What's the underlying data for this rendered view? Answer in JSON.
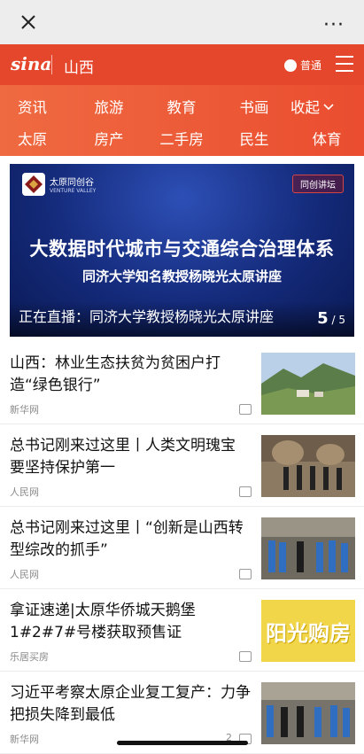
{
  "topbar": {
    "more_label": "···"
  },
  "header": {
    "logo_text": "sina",
    "region": "山西",
    "mode_label": "普通"
  },
  "nav": {
    "row1": [
      "资讯",
      "旅游",
      "教育",
      "书画"
    ],
    "collapse_label": "收起",
    "row2": [
      "太原",
      "房产",
      "二手房",
      "民生",
      "体育"
    ]
  },
  "banner": {
    "org_name": "太原同创谷",
    "org_sub": "VENTURE VALLEY",
    "badge": "同创讲坛",
    "title": "大数据时代城市与交通综合治理体系",
    "subtitle": "同济大学知名教授杨晓光太原讲座",
    "caption": "正在直播：同济大学教授杨晓光太原讲座",
    "page_current": "5",
    "page_total": "/ 5"
  },
  "news": [
    {
      "headline": "山西：林业生态扶贫为贫困户打造“绿色银行”",
      "source": "新华网",
      "comments": ""
    },
    {
      "headline": "总书记刚来过这里丨人类文明瑰宝 要坚持保护第一",
      "source": "人民网",
      "comments": ""
    },
    {
      "headline": "总书记刚来过这里丨“创新是山西转型综改的抓手”",
      "source": "人民网",
      "comments": ""
    },
    {
      "headline": "拿证速递|太原华侨城天鹅堡1#2#7#号楼获取预售证",
      "source": "乐居买房",
      "comments": ""
    },
    {
      "headline": "习近平考察太原企业复工复产：力争把损失降到最低",
      "source": "新华网",
      "comments": "2"
    }
  ],
  "thumb_text": {
    "ad": "阳光购房"
  },
  "colors": {
    "brand": "#e5472c",
    "nav_start": "#ef6a41",
    "banner_bg": "#142a7a"
  }
}
